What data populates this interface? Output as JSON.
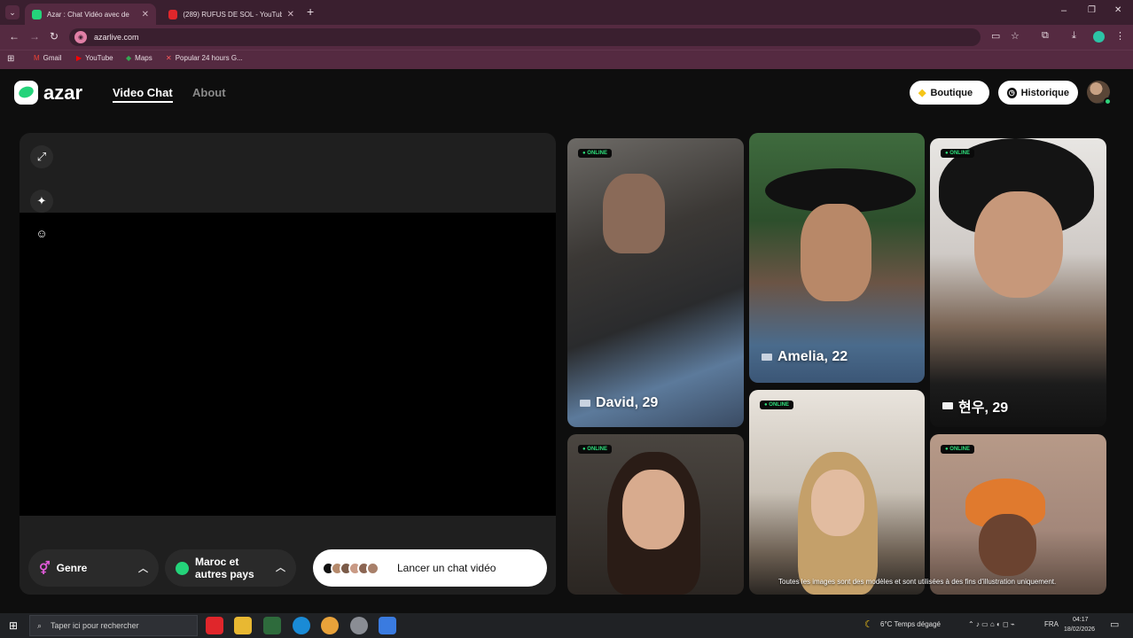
{
  "browser": {
    "tabs": [
      {
        "title": "Azar : Chat Vidéo avec de",
        "active": true
      },
      {
        "title": "(289) RUFUS DE SOL - YouTube",
        "active": false
      }
    ],
    "new_tab": "+",
    "url": "azarlive.com",
    "window_controls": [
      "–",
      "❐",
      "✕"
    ],
    "bookmarks": [
      "Gmail",
      "YouTube",
      "Maps",
      "Popular 24 hours G..."
    ]
  },
  "header": {
    "logo": "azar",
    "nav": [
      "Video Chat",
      "About"
    ],
    "boutique": "Boutique",
    "historique": "Historique"
  },
  "left_panel": {
    "filters": {
      "genre": "Genre",
      "pays_line1": "Maroc et",
      "pays_line2": "autres pays"
    },
    "start_button": "Lancer un chat vidéo"
  },
  "profiles": [
    {
      "name": "David, 29",
      "status": "ONLINE"
    },
    {
      "name": "Amelia, 22",
      "status": ""
    },
    {
      "name": "현우, 29",
      "status": "ONLINE"
    },
    {
      "name": "",
      "status": "ONLINE"
    },
    {
      "name": "",
      "status": "ONLINE"
    },
    {
      "name": "",
      "status": "ONLINE"
    }
  ],
  "disclaimer": "Toutes les images sont des modèles et sont utilisées à des fins d'illustration uniquement.",
  "taskbar": {
    "search_placeholder": "Taper ici pour rechercher",
    "weather": "6°C  Temps dégagé",
    "lang": "FRA",
    "time": "04:17",
    "date": "18/02/2026"
  },
  "colors": {
    "accent_green": "#24d37a",
    "browser_chrome": "#552a41",
    "panel_bg": "#1f1f1f"
  }
}
